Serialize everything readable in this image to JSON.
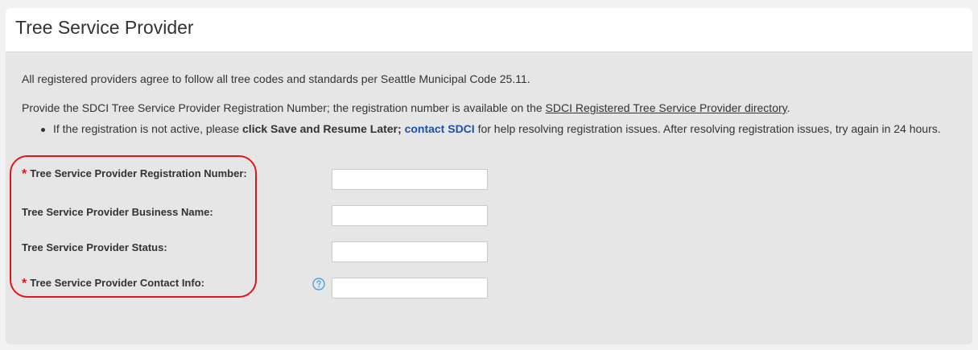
{
  "panel": {
    "title": "Tree Service Provider"
  },
  "content": {
    "intro": "All registered providers agree to follow all tree codes and standards per Seattle Municipal Code 25.11.",
    "instruction_prefix": "Provide the SDCI Tree Service Provider Registration Number; the registration number is available on the ",
    "directory_link": "SDCI Registered Tree Service Provider directory",
    "instruction_suffix": ".",
    "bullet": {
      "prefix": "If the registration is not active, please ",
      "bold_text": "click Save and Resume Later;",
      "link": "contact SDCI",
      "suffix": " for help resolving registration issues. After resolving registration issues, try again in 24 hours."
    }
  },
  "form": {
    "required_marker": "*",
    "fields": [
      {
        "label": "Tree Service Provider Registration Number:",
        "required": true,
        "value": ""
      },
      {
        "label": "Tree Service Provider Business Name:",
        "required": false,
        "value": ""
      },
      {
        "label": "Tree Service Provider Status:",
        "required": false,
        "value": ""
      },
      {
        "label": "Tree Service Provider Contact Info:",
        "required": true,
        "value": "",
        "help_icon": "question-circle-icon"
      }
    ]
  },
  "colors": {
    "required": "#e3151a",
    "highlight_outline": "#e3151a",
    "link_blue": "#1f4fa8",
    "help_icon": "#4aa3df",
    "panel_bg": "#e6e6e6",
    "header_bg": "#ffffff"
  }
}
